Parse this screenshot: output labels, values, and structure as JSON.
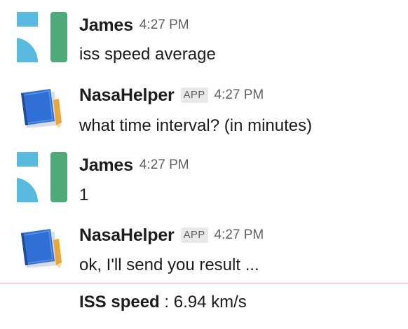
{
  "messages": [
    {
      "sender": "James",
      "time": "4:27 PM",
      "text": "iss speed average",
      "avatar": "user-avatar-icon"
    },
    {
      "sender": "NasaHelper",
      "badge": "APP",
      "time": "4:27 PM",
      "text": "what time interval? (in minutes)",
      "avatar": "notebook-pencil-icon"
    },
    {
      "sender": "James",
      "time": "4:27 PM",
      "text": "1",
      "avatar": "user-avatar-icon"
    },
    {
      "sender": "NasaHelper",
      "badge": "APP",
      "time": "4:27 PM",
      "text": "ok, I'll send you result ...",
      "avatar": "notebook-pencil-icon"
    }
  ],
  "result": {
    "label": "ISS speed",
    "value": " : 6.94 km/s"
  },
  "colors": {
    "user_avatar_blue": "#5ab9df",
    "user_avatar_green": "#4eaa78",
    "bot_book_blue": "#2f6fd6",
    "bot_pencil": "#e8a73a",
    "divider": "#e8a6b4"
  }
}
